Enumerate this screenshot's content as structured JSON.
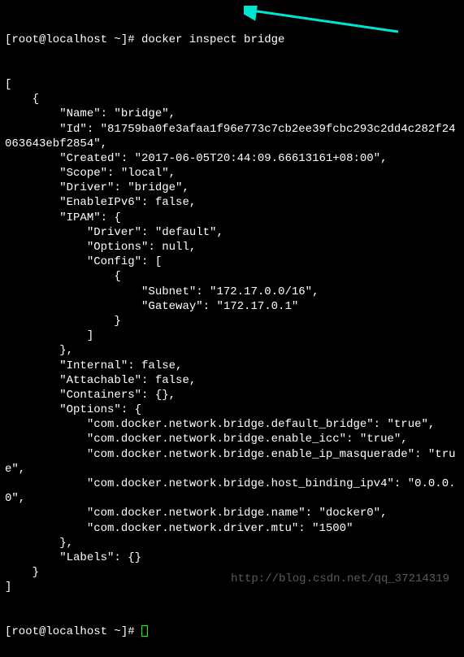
{
  "prompt1": {
    "user": "[root@localhost ~]# ",
    "command": "docker inspect bridge"
  },
  "output_lines": [
    "[",
    "    {",
    "        \"Name\": \"bridge\",",
    "        \"Id\": \"81759ba0fe3afaa1f96e773c7cb2ee39fcbc293c2dd4c282f24063643ebf2854\",",
    "        \"Created\": \"2017-06-05T20:44:09.66613161+08:00\",",
    "        \"Scope\": \"local\",",
    "        \"Driver\": \"bridge\",",
    "        \"EnableIPv6\": false,",
    "        \"IPAM\": {",
    "            \"Driver\": \"default\",",
    "            \"Options\": null,",
    "            \"Config\": [",
    "                {",
    "                    \"Subnet\": \"172.17.0.0/16\",",
    "                    \"Gateway\": \"172.17.0.1\"",
    "                }",
    "            ]",
    "        },",
    "        \"Internal\": false,",
    "        \"Attachable\": false,",
    "        \"Containers\": {},",
    "        \"Options\": {",
    "            \"com.docker.network.bridge.default_bridge\": \"true\",",
    "            \"com.docker.network.bridge.enable_icc\": \"true\",",
    "            \"com.docker.network.bridge.enable_ip_masquerade\": \"true\",",
    "            \"com.docker.network.bridge.host_binding_ipv4\": \"0.0.0.0\",",
    "            \"com.docker.network.bridge.name\": \"docker0\",",
    "            \"com.docker.network.driver.mtu\": \"1500\"",
    "        },",
    "        \"Labels\": {}",
    "    }",
    "]"
  ],
  "prompt2": {
    "user": "[root@localhost ~]# "
  },
  "watermark": "http://blog.csdn.net/qq_37214319",
  "chart_data": {
    "type": "table",
    "title": "docker inspect bridge output",
    "network": {
      "Name": "bridge",
      "Id": "81759ba0fe3afaa1f96e773c7cb2ee39fcbc293c2dd4c282f24063643ebf2854",
      "Created": "2017-06-05T20:44:09.66613161+08:00",
      "Scope": "local",
      "Driver": "bridge",
      "EnableIPv6": false,
      "IPAM": {
        "Driver": "default",
        "Options": null,
        "Config": [
          {
            "Subnet": "172.17.0.0/16",
            "Gateway": "172.17.0.1"
          }
        ]
      },
      "Internal": false,
      "Attachable": false,
      "Containers": {},
      "Options": {
        "com.docker.network.bridge.default_bridge": "true",
        "com.docker.network.bridge.enable_icc": "true",
        "com.docker.network.bridge.enable_ip_masquerade": "true",
        "com.docker.network.bridge.host_binding_ipv4": "0.0.0.0",
        "com.docker.network.bridge.name": "docker0",
        "com.docker.network.driver.mtu": "1500"
      },
      "Labels": {}
    }
  }
}
